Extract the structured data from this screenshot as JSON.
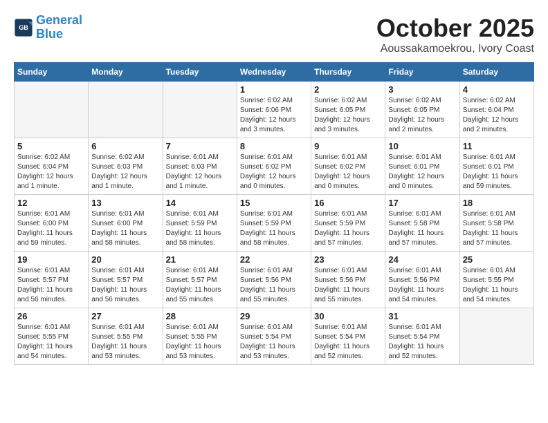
{
  "logo": {
    "line1": "General",
    "line2": "Blue"
  },
  "title": "October 2025",
  "subtitle": "Aoussakamoekrou, Ivory Coast",
  "days_of_week": [
    "Sunday",
    "Monday",
    "Tuesday",
    "Wednesday",
    "Thursday",
    "Friday",
    "Saturday"
  ],
  "weeks": [
    [
      {
        "day": "",
        "info": ""
      },
      {
        "day": "",
        "info": ""
      },
      {
        "day": "",
        "info": ""
      },
      {
        "day": "1",
        "info": "Sunrise: 6:02 AM\nSunset: 6:06 PM\nDaylight: 12 hours\nand 3 minutes."
      },
      {
        "day": "2",
        "info": "Sunrise: 6:02 AM\nSunset: 6:05 PM\nDaylight: 12 hours\nand 3 minutes."
      },
      {
        "day": "3",
        "info": "Sunrise: 6:02 AM\nSunset: 6:05 PM\nDaylight: 12 hours\nand 2 minutes."
      },
      {
        "day": "4",
        "info": "Sunrise: 6:02 AM\nSunset: 6:04 PM\nDaylight: 12 hours\nand 2 minutes."
      }
    ],
    [
      {
        "day": "5",
        "info": "Sunrise: 6:02 AM\nSunset: 6:04 PM\nDaylight: 12 hours\nand 1 minute."
      },
      {
        "day": "6",
        "info": "Sunrise: 6:02 AM\nSunset: 6:03 PM\nDaylight: 12 hours\nand 1 minute."
      },
      {
        "day": "7",
        "info": "Sunrise: 6:01 AM\nSunset: 6:03 PM\nDaylight: 12 hours\nand 1 minute."
      },
      {
        "day": "8",
        "info": "Sunrise: 6:01 AM\nSunset: 6:02 PM\nDaylight: 12 hours\nand 0 minutes."
      },
      {
        "day": "9",
        "info": "Sunrise: 6:01 AM\nSunset: 6:02 PM\nDaylight: 12 hours\nand 0 minutes."
      },
      {
        "day": "10",
        "info": "Sunrise: 6:01 AM\nSunset: 6:01 PM\nDaylight: 12 hours\nand 0 minutes."
      },
      {
        "day": "11",
        "info": "Sunrise: 6:01 AM\nSunset: 6:01 PM\nDaylight: 11 hours\nand 59 minutes."
      }
    ],
    [
      {
        "day": "12",
        "info": "Sunrise: 6:01 AM\nSunset: 6:00 PM\nDaylight: 11 hours\nand 59 minutes."
      },
      {
        "day": "13",
        "info": "Sunrise: 6:01 AM\nSunset: 6:00 PM\nDaylight: 11 hours\nand 58 minutes."
      },
      {
        "day": "14",
        "info": "Sunrise: 6:01 AM\nSunset: 5:59 PM\nDaylight: 11 hours\nand 58 minutes."
      },
      {
        "day": "15",
        "info": "Sunrise: 6:01 AM\nSunset: 5:59 PM\nDaylight: 11 hours\nand 58 minutes."
      },
      {
        "day": "16",
        "info": "Sunrise: 6:01 AM\nSunset: 5:59 PM\nDaylight: 11 hours\nand 57 minutes."
      },
      {
        "day": "17",
        "info": "Sunrise: 6:01 AM\nSunset: 5:58 PM\nDaylight: 11 hours\nand 57 minutes."
      },
      {
        "day": "18",
        "info": "Sunrise: 6:01 AM\nSunset: 5:58 PM\nDaylight: 11 hours\nand 57 minutes."
      }
    ],
    [
      {
        "day": "19",
        "info": "Sunrise: 6:01 AM\nSunset: 5:57 PM\nDaylight: 11 hours\nand 56 minutes."
      },
      {
        "day": "20",
        "info": "Sunrise: 6:01 AM\nSunset: 5:57 PM\nDaylight: 11 hours\nand 56 minutes."
      },
      {
        "day": "21",
        "info": "Sunrise: 6:01 AM\nSunset: 5:57 PM\nDaylight: 11 hours\nand 55 minutes."
      },
      {
        "day": "22",
        "info": "Sunrise: 6:01 AM\nSunset: 5:56 PM\nDaylight: 11 hours\nand 55 minutes."
      },
      {
        "day": "23",
        "info": "Sunrise: 6:01 AM\nSunset: 5:56 PM\nDaylight: 11 hours\nand 55 minutes."
      },
      {
        "day": "24",
        "info": "Sunrise: 6:01 AM\nSunset: 5:56 PM\nDaylight: 11 hours\nand 54 minutes."
      },
      {
        "day": "25",
        "info": "Sunrise: 6:01 AM\nSunset: 5:55 PM\nDaylight: 11 hours\nand 54 minutes."
      }
    ],
    [
      {
        "day": "26",
        "info": "Sunrise: 6:01 AM\nSunset: 5:55 PM\nDaylight: 11 hours\nand 54 minutes."
      },
      {
        "day": "27",
        "info": "Sunrise: 6:01 AM\nSunset: 5:55 PM\nDaylight: 11 hours\nand 53 minutes."
      },
      {
        "day": "28",
        "info": "Sunrise: 6:01 AM\nSunset: 5:55 PM\nDaylight: 11 hours\nand 53 minutes."
      },
      {
        "day": "29",
        "info": "Sunrise: 6:01 AM\nSunset: 5:54 PM\nDaylight: 11 hours\nand 53 minutes."
      },
      {
        "day": "30",
        "info": "Sunrise: 6:01 AM\nSunset: 5:54 PM\nDaylight: 11 hours\nand 52 minutes."
      },
      {
        "day": "31",
        "info": "Sunrise: 6:01 AM\nSunset: 5:54 PM\nDaylight: 11 hours\nand 52 minutes."
      },
      {
        "day": "",
        "info": ""
      }
    ]
  ]
}
